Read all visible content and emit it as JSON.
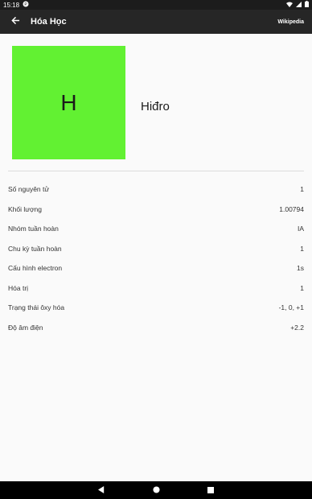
{
  "status_bar": {
    "time": "15:18"
  },
  "app_bar": {
    "title": "Hóa Học",
    "wikipedia_label": "Wikipedia"
  },
  "element": {
    "symbol": "H",
    "name": "Hiđro",
    "tile_color": "#62f132"
  },
  "properties": [
    {
      "label": "Số nguyên tử",
      "value": "1"
    },
    {
      "label": "Khối lượng",
      "value": "1.00794"
    },
    {
      "label": "Nhóm tuần hoàn",
      "value": "IA"
    },
    {
      "label": "Chu kỳ tuần hoàn",
      "value": "1"
    },
    {
      "label": "Cấu hình electron",
      "value": "1s"
    },
    {
      "label": "Hóa trị",
      "value": "1"
    },
    {
      "label": "Trạng thái ôxy hóa",
      "value": "-1, 0, +1"
    },
    {
      "label": "Độ âm điện",
      "value": "+2.2"
    }
  ],
  "icons": [
    "back-arrow-icon",
    "nav-back-icon",
    "nav-home-icon",
    "nav-recents-icon"
  ]
}
